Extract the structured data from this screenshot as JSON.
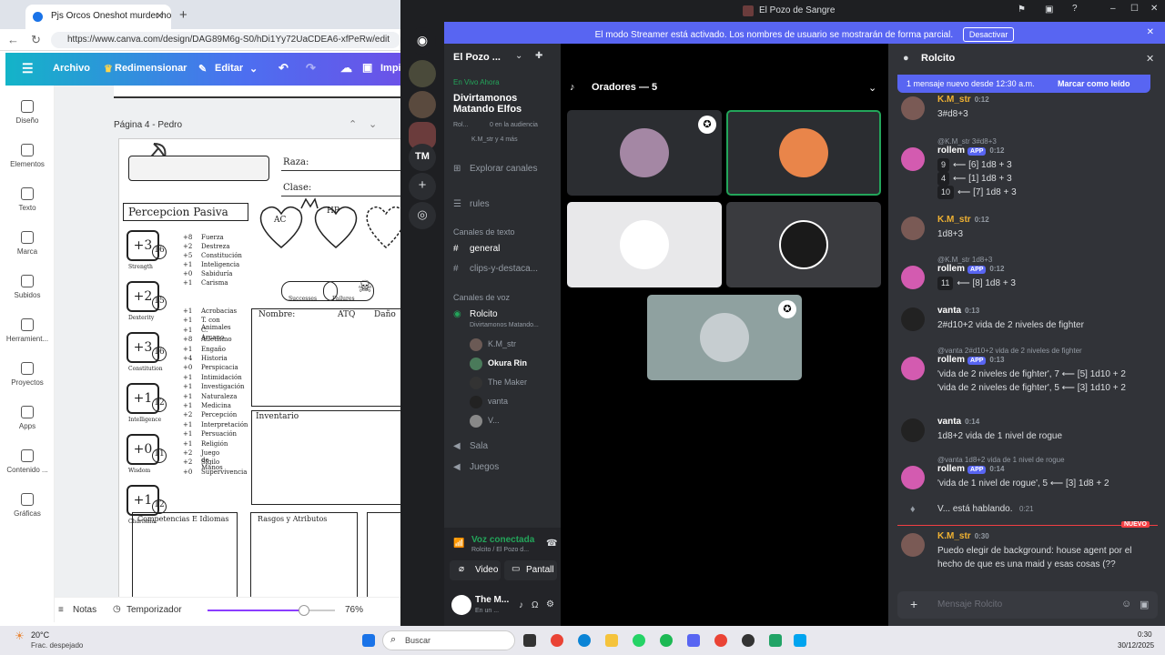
{
  "browser": {
    "tab_title": "Pjs Orcos Oneshot murder hobo -",
    "url": "https://www.canva.com/design/DAG89M6g-S0/hDi1Yy72UaCDEA6-xfPeRw/edit",
    "menu": {
      "archivo": "Archivo",
      "redimensionar": "Redimensionar",
      "editar": "Editar",
      "imprimir": "Impi"
    },
    "sidebar": [
      {
        "label": "Diseño",
        "icon": "layout-icon"
      },
      {
        "label": "Elementos",
        "icon": "shapes-icon"
      },
      {
        "label": "Texto",
        "icon": "text-icon"
      },
      {
        "label": "Marca",
        "icon": "crown-icon"
      },
      {
        "label": "Subidos",
        "icon": "cloud-upload-icon"
      },
      {
        "label": "Herramient...",
        "icon": "pen-icon"
      },
      {
        "label": "Proyectos",
        "icon": "folder-icon"
      },
      {
        "label": "Apps",
        "icon": "grid-icon"
      },
      {
        "label": "Contenido ...",
        "icon": "book-icon"
      },
      {
        "label": "Gráficas",
        "icon": "chart-icon"
      }
    ],
    "page_label": "Página 4 - Pedro",
    "sheet": {
      "raza": "Raza:",
      "clase": "Clase:",
      "percepcion": "Percepcion Pasiva",
      "ac": "AC",
      "hp": "HP",
      "successes": "Successes",
      "failures": "Failures",
      "nombre": "Nombre:",
      "atq": "ATQ",
      "dano": "Daño",
      "inventario": "Inventario",
      "competencias": "Competencias E Idiomas",
      "rasgos": "Rasgos y Atributos",
      "stats": [
        {
          "mod": "+3",
          "score": "16",
          "name": "Strength"
        },
        {
          "mod": "+2",
          "score": "15",
          "name": "Dexterity"
        },
        {
          "mod": "+3",
          "score": "16",
          "name": "Constitution"
        },
        {
          "mod": "+1",
          "score": "12",
          "name": "Intelligence"
        },
        {
          "mod": "+0",
          "score": "11",
          "name": "Wisdom"
        },
        {
          "mod": "+1",
          "score": "12",
          "name": "Charisma"
        }
      ],
      "saves": [
        [
          "+8",
          "Fuerza"
        ],
        [
          "+2",
          "Destreza"
        ],
        [
          "+5",
          "Constitución"
        ],
        [
          "+1",
          "Inteligencia"
        ],
        [
          "+0",
          "Sabiduría"
        ],
        [
          "+1",
          "Carisma"
        ]
      ],
      "skills": [
        [
          "+1",
          "Acrobacias"
        ],
        [
          "+1",
          "T. con Animales"
        ],
        [
          "+1",
          "C. Arcano"
        ],
        [
          "+8",
          "Atletismo"
        ],
        [
          "+1",
          "Engaño"
        ],
        [
          "+4",
          "Historia"
        ],
        [
          "+0",
          "Perspicacia"
        ],
        [
          "+1",
          "Intimidación"
        ],
        [
          "+1",
          "Investigación"
        ],
        [
          "+1",
          "Naturaleza"
        ],
        [
          "+1",
          "Medicina"
        ],
        [
          "+2",
          "Percepción"
        ],
        [
          "+1",
          "Interpretación"
        ],
        [
          "+1",
          "Persuación"
        ],
        [
          "+1",
          "Religión"
        ],
        [
          "+2",
          "Juego de Manos"
        ],
        [
          "+2",
          "Sigilo"
        ],
        [
          "+0",
          "Supervivencia"
        ]
      ]
    },
    "footer": {
      "notas": "Notas",
      "temporizador": "Temporizador",
      "zoom": "76%"
    },
    "zoom_level": 0.76
  },
  "discord": {
    "window_title": "El Pozo de Sangre",
    "streamer_text": "El modo Streamer está activado. Los nombres de usuario se mostrarán de forma parcial.",
    "streamer_button": "Desactivar",
    "server_name": "El Pozo ...",
    "guild_tm": "TM",
    "live": {
      "label": "En Vivo Ahora",
      "title": "Divirtamonos Matando Elfos",
      "channel": "Rol...",
      "audience": "0 en la audiencia",
      "users": "K.M_str y 4 más"
    },
    "explore": "Explorar canales",
    "rules": "rules",
    "text_category": "Canales de texto",
    "text_channels": [
      "general",
      "clips-y-destaca..."
    ],
    "voice_category": "Canales de voz",
    "voice_channel": "Rolcito",
    "voice_sub": "Divirtamonos Matando...",
    "voice_users": [
      "K.M_str",
      "Okura Rin",
      "The Maker",
      "vanta",
      "V..."
    ],
    "other_voice": [
      "Sala",
      "Juegos"
    ],
    "voice_connected": "Voz conectada",
    "voice_location": "Rolcito / El Pozo d...",
    "video_btn": "Video",
    "screen_btn": "Pantall",
    "user": {
      "name": "The M...",
      "status": "En un ..."
    },
    "speakers_header": "Oradores — 5",
    "chat": {
      "channel": "Rolcito",
      "new_banner": "1 mensaje nuevo desde 12:30 a.m.",
      "mark_read": "Marcar como leído",
      "new_tag": "NUEVO",
      "input_placeholder": "Mensaje Rolcito",
      "speaking": "V... está hablando.",
      "speaking_time": "0:21",
      "messages": [
        {
          "name": "K.M_str",
          "time": "0:12",
          "lines": [
            "3#d8+3"
          ],
          "color": "#f0b232"
        },
        {
          "reply": "@K.M_str 3#d8+3",
          "name": "rollem",
          "app": "APP",
          "time": "0:12",
          "lines": [
            [
              "9",
              "⟵ [6] 1d8 + 3"
            ],
            [
              "4",
              "⟵ [1] 1d8 + 3"
            ],
            [
              "10",
              "⟵ [7] 1d8 + 3"
            ]
          ],
          "color": "#ffffff"
        },
        {
          "name": "K.M_str",
          "time": "0:12",
          "lines": [
            "1d8+3"
          ],
          "color": "#f0b232"
        },
        {
          "reply": "@K.M_str 1d8+3",
          "name": "rollem",
          "app": "APP",
          "time": "0:12",
          "lines": [
            [
              "11",
              "⟵ [8] 1d8 + 3"
            ]
          ],
          "color": "#ffffff"
        },
        {
          "name": "vanta",
          "time": "0:13",
          "lines": [
            "2#d10+2 vida de 2 niveles de fighter"
          ],
          "color": "#ffffff"
        },
        {
          "reply": "@vanta 2#d10+2 vida de 2 niveles de fighter",
          "name": "rollem",
          "app": "APP",
          "time": "0:13",
          "lines": [
            "'vida de 2 niveles de fighter', 7 ⟵ [5] 1d10 + 2",
            "'vida de 2 niveles de fighter', 5 ⟵ [3] 1d10 + 2"
          ],
          "color": "#ffffff"
        },
        {
          "name": "vanta",
          "time": "0:14",
          "lines": [
            "1d8+2 vida de 1 nivel de rogue"
          ],
          "color": "#ffffff"
        },
        {
          "reply": "@vanta 1d8+2 vida de 1 nivel de rogue",
          "name": "rollem",
          "app": "APP",
          "time": "0:14",
          "lines": [
            "'vida de 1 nivel de rogue', 5 ⟵ [3] 1d8 + 2"
          ],
          "color": "#ffffff"
        },
        {
          "name": "K.M_str",
          "time": "0:30",
          "lines": [
            "Puedo elegir de background: house agent por el",
            "hecho de que es una maid y esas cosas (??"
          ],
          "color": "#f0b232"
        }
      ]
    }
  },
  "taskbar": {
    "temp": "20°C",
    "weather": "Frac. despejado",
    "search": "Buscar",
    "time": "0:30",
    "date": "30/12/2025"
  },
  "colors": {
    "discord_accent": "#5865f2",
    "canva_gradient_start": "#13b4c8",
    "canva_gradient_end": "#6b52e8",
    "live_green": "#23a55a",
    "new_red": "#f23f43"
  }
}
